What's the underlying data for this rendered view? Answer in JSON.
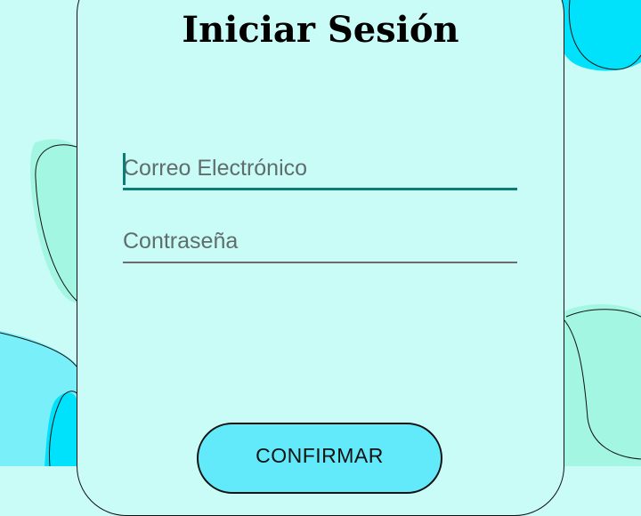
{
  "login": {
    "title": "Iniciar Sesión",
    "email_placeholder": "Correo Electrónico",
    "password_placeholder": "Contraseña",
    "confirm_label": "CONFIRMAR"
  },
  "colors": {
    "background": "#c9fbf7",
    "accent": "#0b7d74",
    "button": "#62e9fa",
    "blob_cyan": "#00e1fb",
    "blob_mint": "#a3f6e1"
  }
}
